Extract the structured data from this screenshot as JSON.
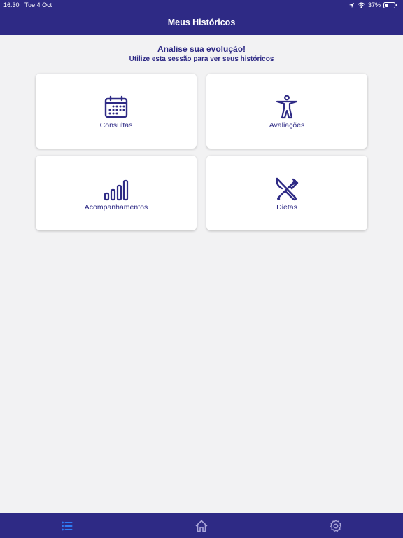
{
  "status_bar": {
    "time": "16:30",
    "date": "Tue 4 Oct",
    "battery": "37%"
  },
  "header": {
    "title": "Meus Históricos"
  },
  "intro": {
    "title": "Analise sua evolução!",
    "subtitle": "Utilize esta sessão para ver seus históricos"
  },
  "cards": [
    {
      "label": "Consultas",
      "icon": "calendar-icon"
    },
    {
      "label": "Avaliações",
      "icon": "person-accessibility-icon"
    },
    {
      "label": "Acompanhamentos",
      "icon": "bar-chart-icon"
    },
    {
      "label": "Dietas",
      "icon": "fork-knife-icon"
    }
  ],
  "tabbar": {
    "items": [
      {
        "icon": "list-icon",
        "active": true
      },
      {
        "icon": "home-icon",
        "active": false
      },
      {
        "icon": "settings-icon",
        "active": false
      }
    ]
  },
  "colors": {
    "primary": "#2e2a85",
    "background": "#f2f2f3",
    "card": "#ffffff",
    "tab_active": "#2f7cf6",
    "tab_inactive": "#a9a5d9"
  }
}
